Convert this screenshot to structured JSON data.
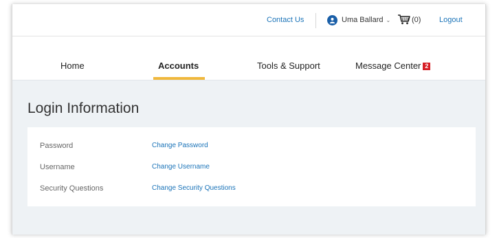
{
  "header": {
    "contact_label": "Contact Us",
    "user_name": "Uma Ballard",
    "cart_count": "(0)",
    "logout_label": "Logout"
  },
  "nav": {
    "tabs": [
      {
        "label": "Home",
        "active": false
      },
      {
        "label": "Accounts",
        "active": true
      },
      {
        "label": "Tools & Support",
        "active": false
      },
      {
        "label": "Message Center",
        "active": false,
        "badge": "2"
      }
    ]
  },
  "main": {
    "title": "Login Information",
    "rows": [
      {
        "label": "Password",
        "action": "Change Password"
      },
      {
        "label": "Username",
        "action": "Change Username"
      },
      {
        "label": "Security Questions",
        "action": "Change Security Questions"
      }
    ]
  },
  "colors": {
    "link": "#1a73b8",
    "active_tab_underline": "#f0b83c",
    "badge": "#d61f26",
    "avatar": "#1a5fa8",
    "content_bg": "#eef2f5"
  },
  "icons": [
    "user-avatar-icon",
    "chevron-down-icon",
    "shopping-cart-icon"
  ]
}
